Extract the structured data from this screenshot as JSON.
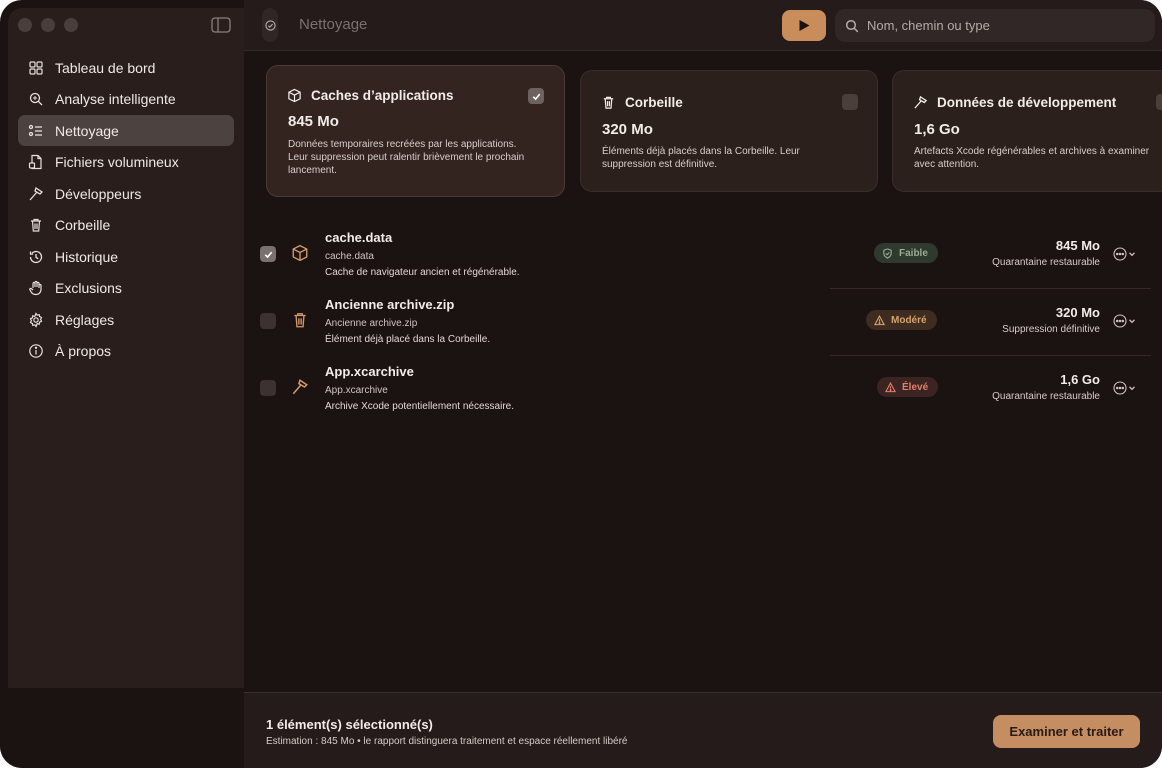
{
  "window": {
    "title": "Nettoyage"
  },
  "sidebar": {
    "items": [
      {
        "label": "Tableau de bord",
        "icon": "grid-icon"
      },
      {
        "label": "Analyse intelligente",
        "icon": "magnifier-sparkle-icon"
      },
      {
        "label": "Nettoyage",
        "icon": "checklist-icon",
        "active": true
      },
      {
        "label": "Fichiers volumineux",
        "icon": "large-file-icon"
      },
      {
        "label": "Développeurs",
        "icon": "hammer-icon"
      },
      {
        "label": "Corbeille",
        "icon": "trash-icon"
      },
      {
        "label": "Historique",
        "icon": "history-icon"
      },
      {
        "label": "Exclusions",
        "icon": "hand-icon"
      },
      {
        "label": "Réglages",
        "icon": "gear-icon"
      },
      {
        "label": "À propos",
        "icon": "info-icon"
      }
    ]
  },
  "toolbar": {
    "title": "Nettoyage",
    "run_icon": "play-icon",
    "search_placeholder": "Nom, chemin ou type"
  },
  "cards": [
    {
      "title": "Caches d’applications",
      "size": "845 Mo",
      "desc_lines": [
        "Données temporaires recréées par les applications.",
        "Leur suppression peut ralentir brièvement le prochain",
        "lancement."
      ],
      "checked": true,
      "icon": "box-icon"
    },
    {
      "title": "Corbeille",
      "size": "320 Mo",
      "desc_lines": [
        "Éléments déjà placés dans la Corbeille. Leur",
        "suppression est définitive."
      ],
      "checked": false,
      "icon": "trash-icon"
    },
    {
      "title": "Données de développement",
      "size": "1,6 Go",
      "desc_lines": [
        "Artefacts Xcode régénérables et archives à examiner",
        "avec attention."
      ],
      "checked": false,
      "icon": "hammer-icon"
    }
  ],
  "rows": [
    {
      "name": "cache.data",
      "file": "cache.data",
      "desc": "Cache de navigateur ancien et régénérable.",
      "risk": "Faible",
      "size": "845 Mo",
      "mode": "Quarantaine restaurable",
      "checked": true,
      "icon": "box-icon"
    },
    {
      "name": "Ancienne archive.zip",
      "file": "Ancienne archive.zip",
      "desc": "Élément déjà placé dans la Corbeille.",
      "risk": "Modéré",
      "size": "320 Mo",
      "mode": "Suppression définitive",
      "checked": false,
      "icon": "trash-icon"
    },
    {
      "name": "App.xcarchive",
      "file": "App.xcarchive",
      "desc": "Archive Xcode potentiellement nécessaire.",
      "risk": "Élevé",
      "size": "1,6 Go",
      "mode": "Quarantaine restaurable",
      "checked": false,
      "icon": "hammer-icon"
    }
  ],
  "bottom": {
    "selected": "1 élément(s) sélectionné(s)",
    "estimate": "Estimation : 845 Mo • le rapport distinguera traitement et espace réellement libéré",
    "process_button": "Examiner et traiter"
  },
  "colors": {
    "accent": "#c98d5c",
    "risk_low": "#8fa08a",
    "risk_medium": "#d6a36c",
    "risk_high": "#e0806c"
  }
}
